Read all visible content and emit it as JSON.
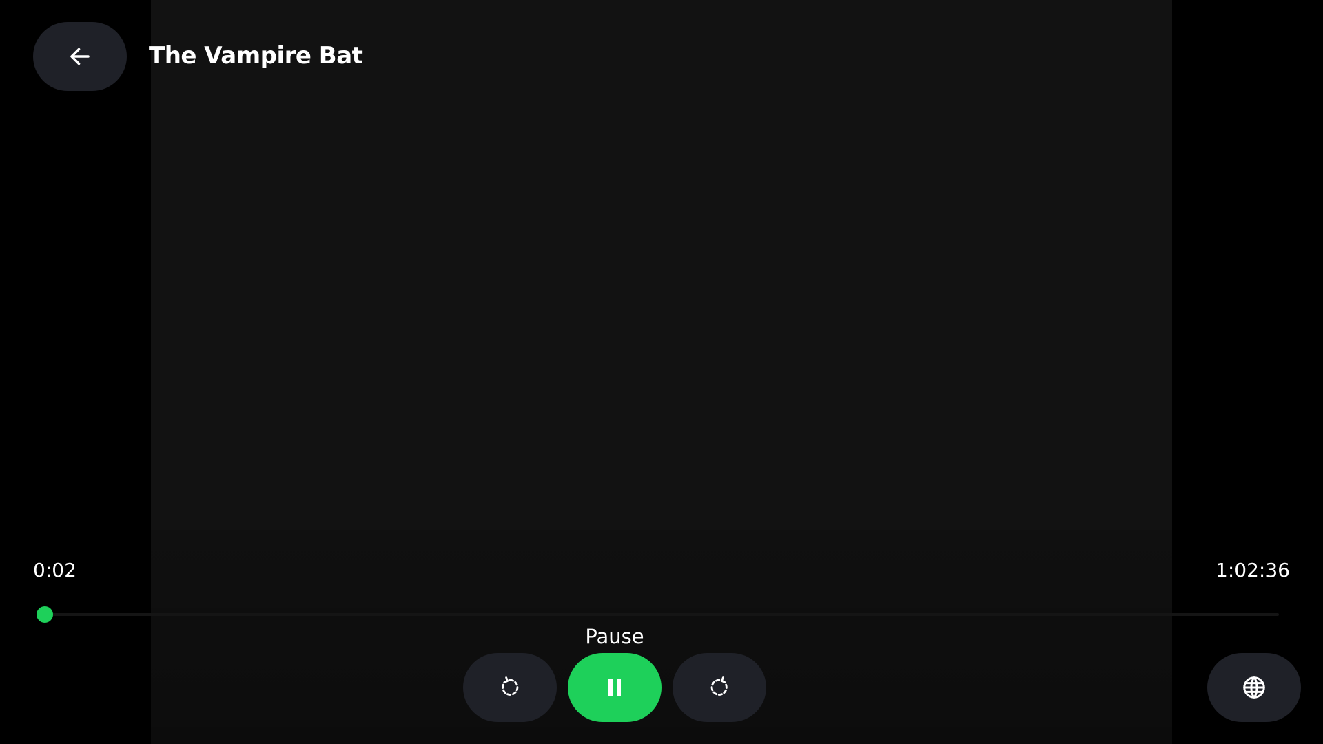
{
  "player": {
    "title": "The Vampire Bat",
    "current_time": "0:02",
    "total_time": "1:02:36",
    "progress_fraction": 0.0005,
    "tooltip": "Pause",
    "state": "playing"
  },
  "controls": {
    "back_icon": "arrow-left-icon",
    "rewind_icon": "rewind-10-icon",
    "pause_icon": "pause-icon",
    "forward_icon": "forward-10-icon",
    "language_icon": "globe-icon"
  },
  "colors": {
    "accent": "#1ed05a",
    "button_bg": "#1f2128",
    "video_bg": "#121212",
    "page_bg": "#000000"
  }
}
